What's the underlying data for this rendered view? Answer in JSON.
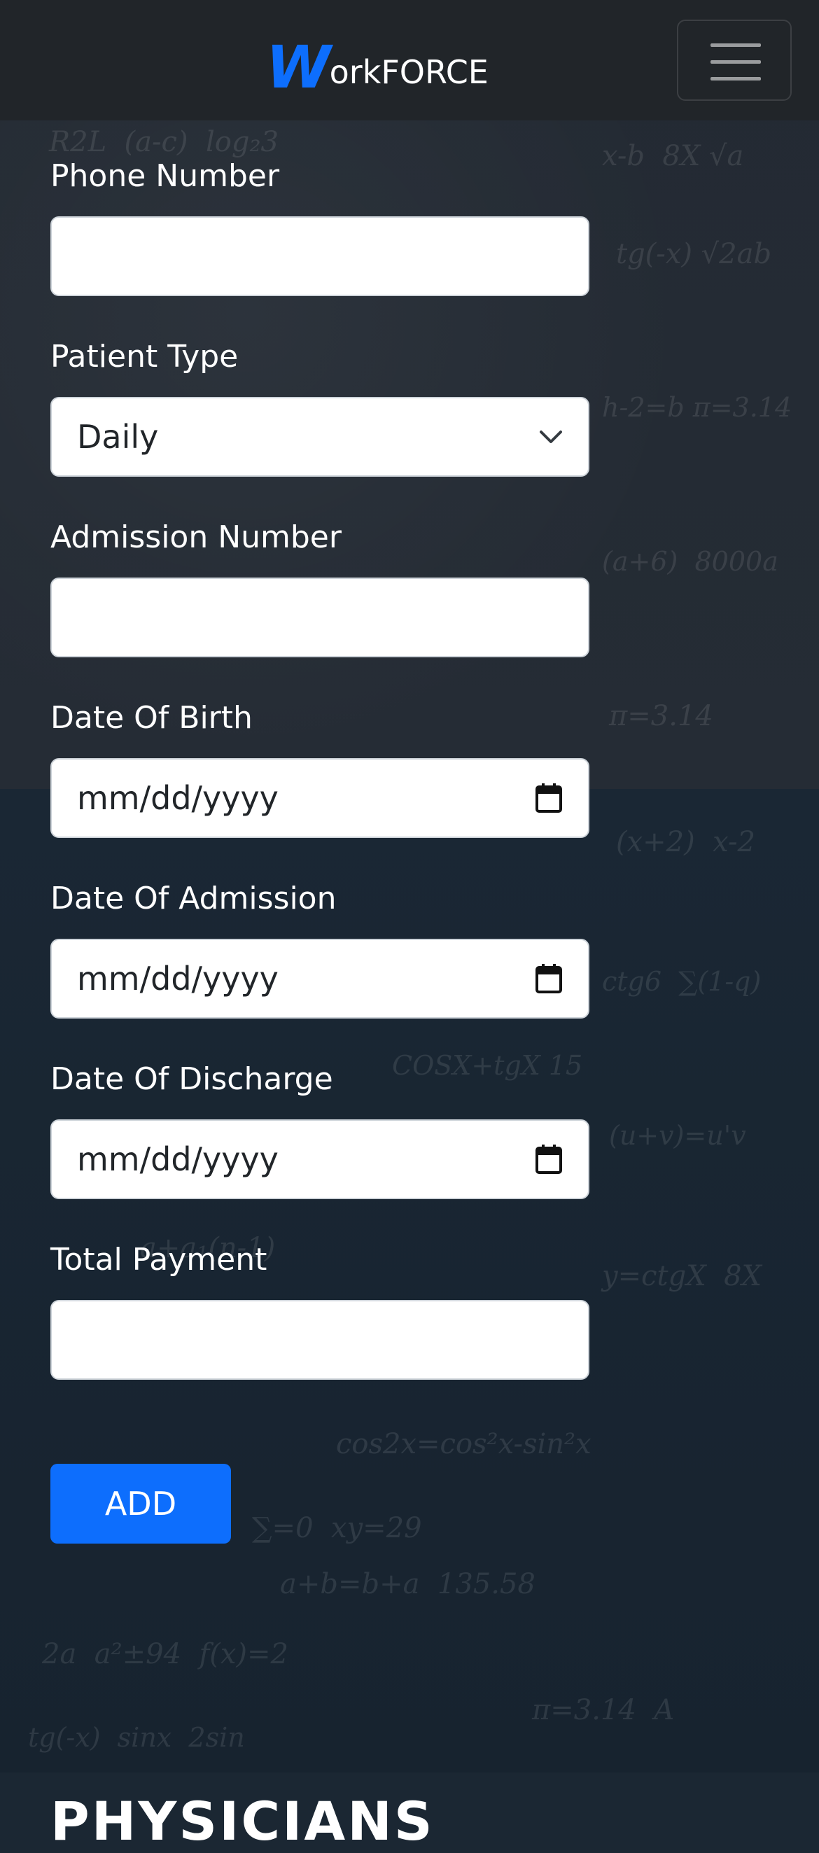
{
  "navbar": {
    "brand_initial": "W",
    "brand_rest": "orkFORCE",
    "menu_icon": "hamburger-menu-icon"
  },
  "form": {
    "phone": {
      "label": "Phone Number",
      "value": ""
    },
    "patient_type": {
      "label": "Patient Type",
      "value": "Daily",
      "icon": "chevron-down-icon"
    },
    "admission_number": {
      "label": "Admission Number",
      "value": ""
    },
    "date_of_birth": {
      "label": "Date Of Birth",
      "placeholder": "mm/dd/yyyy",
      "icon": "calendar-icon"
    },
    "date_of_admission": {
      "label": "Date Of Admission",
      "placeholder": "mm/dd/yyyy",
      "icon": "calendar-icon"
    },
    "date_of_discharge": {
      "label": "Date Of Discharge",
      "placeholder": "mm/dd/yyyy",
      "icon": "calendar-icon"
    },
    "total_payment": {
      "label": "Total Payment",
      "value": ""
    },
    "add_button": "ADD"
  },
  "next_section": {
    "title": "PHYSICIANS"
  },
  "colors": {
    "navbar": "#212529",
    "accent": "#0d6efd",
    "background": "#1b2733",
    "label": "#ffffff"
  }
}
